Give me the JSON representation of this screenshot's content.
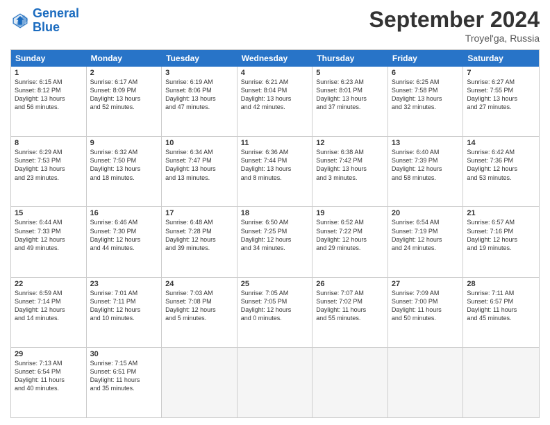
{
  "header": {
    "logo_general": "General",
    "logo_blue": "Blue",
    "month_title": "September 2024",
    "location": "Troyel'ga, Russia"
  },
  "days_of_week": [
    "Sunday",
    "Monday",
    "Tuesday",
    "Wednesday",
    "Thursday",
    "Friday",
    "Saturday"
  ],
  "weeks": [
    [
      {
        "day": "1",
        "lines": [
          "Sunrise: 6:15 AM",
          "Sunset: 8:12 PM",
          "Daylight: 13 hours",
          "and 56 minutes."
        ]
      },
      {
        "day": "2",
        "lines": [
          "Sunrise: 6:17 AM",
          "Sunset: 8:09 PM",
          "Daylight: 13 hours",
          "and 52 minutes."
        ]
      },
      {
        "day": "3",
        "lines": [
          "Sunrise: 6:19 AM",
          "Sunset: 8:06 PM",
          "Daylight: 13 hours",
          "and 47 minutes."
        ]
      },
      {
        "day": "4",
        "lines": [
          "Sunrise: 6:21 AM",
          "Sunset: 8:04 PM",
          "Daylight: 13 hours",
          "and 42 minutes."
        ]
      },
      {
        "day": "5",
        "lines": [
          "Sunrise: 6:23 AM",
          "Sunset: 8:01 PM",
          "Daylight: 13 hours",
          "and 37 minutes."
        ]
      },
      {
        "day": "6",
        "lines": [
          "Sunrise: 6:25 AM",
          "Sunset: 7:58 PM",
          "Daylight: 13 hours",
          "and 32 minutes."
        ]
      },
      {
        "day": "7",
        "lines": [
          "Sunrise: 6:27 AM",
          "Sunset: 7:55 PM",
          "Daylight: 13 hours",
          "and 27 minutes."
        ]
      }
    ],
    [
      {
        "day": "8",
        "lines": [
          "Sunrise: 6:29 AM",
          "Sunset: 7:53 PM",
          "Daylight: 13 hours",
          "and 23 minutes."
        ]
      },
      {
        "day": "9",
        "lines": [
          "Sunrise: 6:32 AM",
          "Sunset: 7:50 PM",
          "Daylight: 13 hours",
          "and 18 minutes."
        ]
      },
      {
        "day": "10",
        "lines": [
          "Sunrise: 6:34 AM",
          "Sunset: 7:47 PM",
          "Daylight: 13 hours",
          "and 13 minutes."
        ]
      },
      {
        "day": "11",
        "lines": [
          "Sunrise: 6:36 AM",
          "Sunset: 7:44 PM",
          "Daylight: 13 hours",
          "and 8 minutes."
        ]
      },
      {
        "day": "12",
        "lines": [
          "Sunrise: 6:38 AM",
          "Sunset: 7:42 PM",
          "Daylight: 13 hours",
          "and 3 minutes."
        ]
      },
      {
        "day": "13",
        "lines": [
          "Sunrise: 6:40 AM",
          "Sunset: 7:39 PM",
          "Daylight: 12 hours",
          "and 58 minutes."
        ]
      },
      {
        "day": "14",
        "lines": [
          "Sunrise: 6:42 AM",
          "Sunset: 7:36 PM",
          "Daylight: 12 hours",
          "and 53 minutes."
        ]
      }
    ],
    [
      {
        "day": "15",
        "lines": [
          "Sunrise: 6:44 AM",
          "Sunset: 7:33 PM",
          "Daylight: 12 hours",
          "and 49 minutes."
        ]
      },
      {
        "day": "16",
        "lines": [
          "Sunrise: 6:46 AM",
          "Sunset: 7:30 PM",
          "Daylight: 12 hours",
          "and 44 minutes."
        ]
      },
      {
        "day": "17",
        "lines": [
          "Sunrise: 6:48 AM",
          "Sunset: 7:28 PM",
          "Daylight: 12 hours",
          "and 39 minutes."
        ]
      },
      {
        "day": "18",
        "lines": [
          "Sunrise: 6:50 AM",
          "Sunset: 7:25 PM",
          "Daylight: 12 hours",
          "and 34 minutes."
        ]
      },
      {
        "day": "19",
        "lines": [
          "Sunrise: 6:52 AM",
          "Sunset: 7:22 PM",
          "Daylight: 12 hours",
          "and 29 minutes."
        ]
      },
      {
        "day": "20",
        "lines": [
          "Sunrise: 6:54 AM",
          "Sunset: 7:19 PM",
          "Daylight: 12 hours",
          "and 24 minutes."
        ]
      },
      {
        "day": "21",
        "lines": [
          "Sunrise: 6:57 AM",
          "Sunset: 7:16 PM",
          "Daylight: 12 hours",
          "and 19 minutes."
        ]
      }
    ],
    [
      {
        "day": "22",
        "lines": [
          "Sunrise: 6:59 AM",
          "Sunset: 7:14 PM",
          "Daylight: 12 hours",
          "and 14 minutes."
        ]
      },
      {
        "day": "23",
        "lines": [
          "Sunrise: 7:01 AM",
          "Sunset: 7:11 PM",
          "Daylight: 12 hours",
          "and 10 minutes."
        ]
      },
      {
        "day": "24",
        "lines": [
          "Sunrise: 7:03 AM",
          "Sunset: 7:08 PM",
          "Daylight: 12 hours",
          "and 5 minutes."
        ]
      },
      {
        "day": "25",
        "lines": [
          "Sunrise: 7:05 AM",
          "Sunset: 7:05 PM",
          "Daylight: 12 hours",
          "and 0 minutes."
        ]
      },
      {
        "day": "26",
        "lines": [
          "Sunrise: 7:07 AM",
          "Sunset: 7:02 PM",
          "Daylight: 11 hours",
          "and 55 minutes."
        ]
      },
      {
        "day": "27",
        "lines": [
          "Sunrise: 7:09 AM",
          "Sunset: 7:00 PM",
          "Daylight: 11 hours",
          "and 50 minutes."
        ]
      },
      {
        "day": "28",
        "lines": [
          "Sunrise: 7:11 AM",
          "Sunset: 6:57 PM",
          "Daylight: 11 hours",
          "and 45 minutes."
        ]
      }
    ],
    [
      {
        "day": "29",
        "lines": [
          "Sunrise: 7:13 AM",
          "Sunset: 6:54 PM",
          "Daylight: 11 hours",
          "and 40 minutes."
        ]
      },
      {
        "day": "30",
        "lines": [
          "Sunrise: 7:15 AM",
          "Sunset: 6:51 PM",
          "Daylight: 11 hours",
          "and 35 minutes."
        ]
      },
      {
        "day": "",
        "lines": []
      },
      {
        "day": "",
        "lines": []
      },
      {
        "day": "",
        "lines": []
      },
      {
        "day": "",
        "lines": []
      },
      {
        "day": "",
        "lines": []
      }
    ]
  ]
}
